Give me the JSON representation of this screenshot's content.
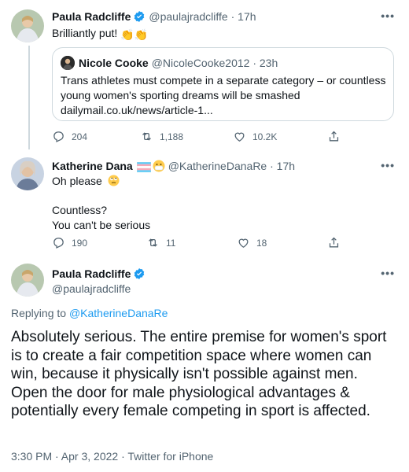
{
  "tweet1": {
    "name": "Paula Radcliffe",
    "handle_time": "@paulajradcliffe · 17h",
    "text": "Brilliantly put!",
    "emoji": "👏👏",
    "quote": {
      "name": "Nicole Cooke",
      "handle_time": "@NicoleCooke2012 · 23h",
      "text": "Trans athletes must compete in a separate category – or countless young women's sporting dreams will be smashed",
      "link": "dailymail.co.uk/news/article-1..."
    },
    "stats": {
      "replies": "204",
      "retweets": "1,188",
      "likes": "10.2K"
    }
  },
  "tweet2": {
    "name": "Katherine Dana",
    "handle_time": "@KatherineDanaRe · 17h",
    "line1": "Oh please",
    "line2": "Countless?",
    "line3": "You can't be serious",
    "stats": {
      "replies": "190",
      "retweets": "11",
      "likes": "18"
    }
  },
  "tweet3": {
    "name": "Paula Radcliffe",
    "handle": "@paulajradcliffe",
    "replying_prefix": "Replying to",
    "replying_to": "@KatherineDanaRe",
    "text": "Absolutely serious. The entire premise for women's sport is to create a fair competition space where women can win, because it physically isn't possible against men. Open the door for male physiological advantages & potentially every female competing in sport is affected.",
    "footer": "3:30 PM · Apr 3, 2022 · Twitter for iPhone"
  },
  "more_label": "•••",
  "colors": {
    "accent": "#1d9bf0",
    "text": "#0f1419",
    "secondary": "#536471",
    "border": "#cfd9de"
  },
  "icons": [
    "verified-badge-icon",
    "reply-icon",
    "retweet-icon",
    "like-icon",
    "share-icon",
    "more-icon",
    "transgender-flag-emoji",
    "face-mask-emoji",
    "clapping-hands-emoji",
    "rolling-eyes-emoji"
  ]
}
